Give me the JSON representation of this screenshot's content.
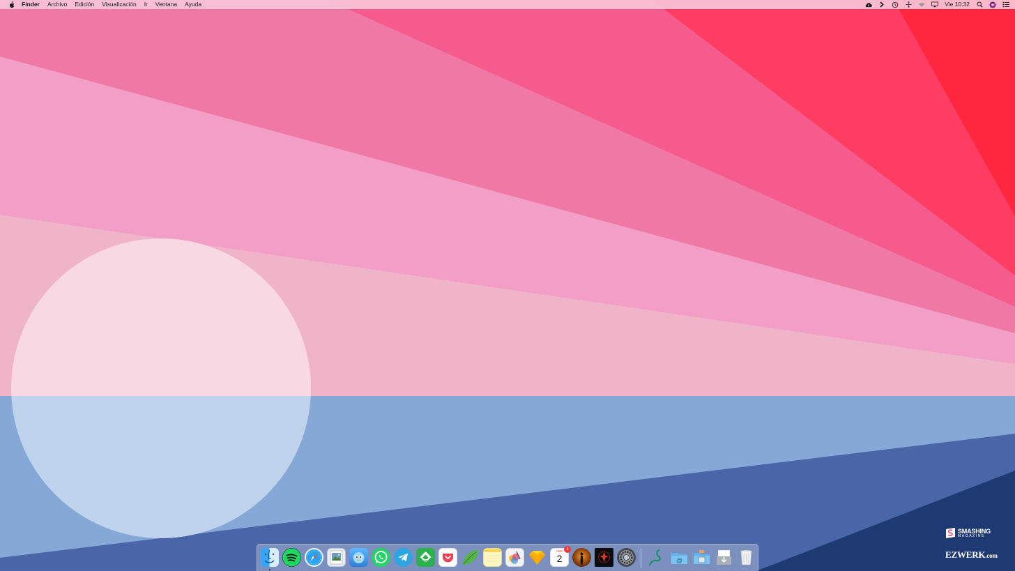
{
  "colors": {
    "menubar": "#f8c4d7",
    "sky_stripes": [
      "#ff2640",
      "#ff3c62",
      "#f65b8e",
      "#ef78a5",
      "#f29ec6",
      "#f0b4c8"
    ],
    "sun_upper": "#f8d8e3",
    "sun_lower": "#c0d3ec",
    "water": [
      "#86a8d6",
      "#4966a6",
      "#1f3a73"
    ]
  },
  "menubar": {
    "apple_icon": "apple-icon",
    "items": [
      "Finder",
      "Archivo",
      "Edición",
      "Visualización",
      "Ir",
      "Ventana",
      "Ayuda"
    ],
    "status_icons": [
      "creative-cloud-icon",
      "chevron-right-icon",
      "time-machine-icon",
      "move-icon",
      "wifi-icon",
      "airplay-icon"
    ],
    "clock": "Vie 10:32",
    "spotlight_icon": "search-icon",
    "user_icon": "siri-icon",
    "notification_icon": "list-icon"
  },
  "dock": {
    "apps": [
      {
        "name": "Finder",
        "icon": "finder-icon"
      },
      {
        "name": "Spotify",
        "icon": "spotify-icon"
      },
      {
        "name": "Safari",
        "icon": "safari-icon"
      },
      {
        "name": "Preview",
        "icon": "preview-icon"
      },
      {
        "name": "Tweetbot",
        "icon": "tweetbot-icon"
      },
      {
        "name": "WhatsApp",
        "icon": "whatsapp-icon"
      },
      {
        "name": "Telegram",
        "icon": "telegram-icon"
      },
      {
        "name": "Feedly",
        "icon": "feedly-icon"
      },
      {
        "name": "Pocket",
        "icon": "pocket-icon"
      },
      {
        "name": "Leaf",
        "icon": "leaf-icon"
      },
      {
        "name": "Notes",
        "icon": "notes-icon"
      },
      {
        "name": "Pixelmator",
        "icon": "pixelmator-icon"
      },
      {
        "name": "Sketch",
        "icon": "sketch-icon"
      },
      {
        "name": "Calendar",
        "icon": "calendar-icon",
        "month": "ABR",
        "day": "2",
        "badge": "1"
      },
      {
        "name": "Silhouette",
        "icon": "silhouette-icon"
      },
      {
        "name": "Dark App",
        "icon": "dark-app-icon"
      },
      {
        "name": "System Preferences",
        "icon": "system-preferences-icon"
      }
    ],
    "folders": [
      {
        "name": "Cable",
        "icon": "cable-icon"
      },
      {
        "name": "Email Folder",
        "icon": "email-folder-icon"
      },
      {
        "name": "Applications",
        "icon": "applications-folder-icon"
      },
      {
        "name": "Downloads",
        "icon": "downloads-folder-icon"
      },
      {
        "name": "Trash",
        "icon": "trash-icon"
      }
    ]
  },
  "watermarks": {
    "smashing_title": "SMASHING",
    "smashing_sub": "MAGAZINE",
    "ezwerk": "EZWERK",
    "ezwerk_domain": ".com"
  }
}
